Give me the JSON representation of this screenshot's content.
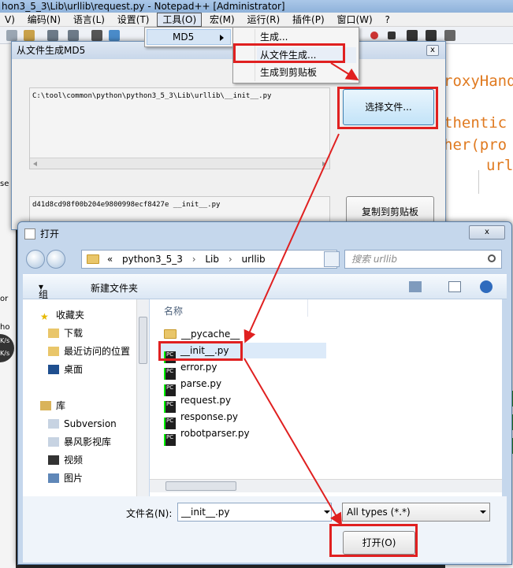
{
  "window": {
    "title": "hon3_5_3\\Lib\\urllib\\request.py - Notepad++ [Administrator]"
  },
  "menubar": {
    "items": [
      "V)",
      "编码(N)",
      "语言(L)",
      "设置(T)",
      "工具(O)",
      "宏(M)",
      "运行(R)",
      "插件(P)",
      "窗口(W)",
      "?"
    ],
    "active_index": 4
  },
  "tools_menu": {
    "item": "MD5"
  },
  "md5_submenu": {
    "items": [
      "生成...",
      "从文件生成...",
      "生成到剪贴板"
    ]
  },
  "editor": {
    "lines": [
      "roxyHand",
      "thentic",
      "her(pro",
      "url"
    ]
  },
  "left_strip": {
    "texts": [
      "se",
      "or",
      "ho",
      "K/s",
      "K/s"
    ]
  },
  "md5_dialog": {
    "title": "从文件生成MD5",
    "close": "x",
    "file_path": "C:\\tool\\common\\python\\python3_5_3\\Lib\\urllib\\__init__.py",
    "choose_button": "选择文件...",
    "hash_result": "d41d8cd98f00b204e9800998ecf8427e  __init__.py",
    "copy_button": "复制到剪贴板"
  },
  "open_dialog": {
    "title": "打开",
    "close": "x",
    "breadcrumb": {
      "prefix": "«",
      "parts": [
        "python3_5_3",
        "Lib",
        "urllib"
      ]
    },
    "search_placeholder": "搜索 urllib",
    "organize": "组织",
    "new_folder": "新建文件夹",
    "nav_items": [
      "收藏夹",
      "下载",
      "最近访问的位置",
      "桌面",
      "库",
      "Subversion",
      "暴风影视库",
      "视频",
      "图片"
    ],
    "column_header": "名称",
    "files": [
      "__pycache__",
      "__init__.py",
      "error.py",
      "parse.py",
      "request.py",
      "response.py",
      "robotparser.py"
    ],
    "selected_file_index": 1,
    "filename_label": "文件名(N):",
    "filename_value": "__init__.py",
    "filetype": "All types (*.*)",
    "open_button": "打开(O)"
  },
  "colors": {
    "annotation_red": "#e02020",
    "editor_text": "#e07a20",
    "selection": "#d6e5f5"
  },
  "icons": [
    "folder-icon",
    "python-file-icon",
    "star-icon",
    "library-icon",
    "search-icon",
    "back-icon",
    "forward-icon",
    "refresh-icon",
    "help-icon"
  ]
}
